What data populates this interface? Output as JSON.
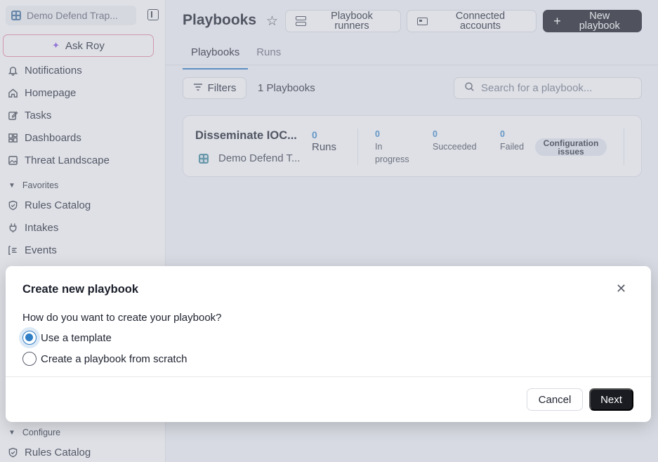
{
  "sidebar": {
    "workspace_name": "Demo Defend Trap...",
    "ask_label": "Ask Roy",
    "items": [
      {
        "label": "Notifications",
        "icon": "bell-icon"
      },
      {
        "label": "Homepage",
        "icon": "home-icon"
      },
      {
        "label": "Tasks",
        "icon": "edit-icon"
      },
      {
        "label": "Dashboards",
        "icon": "dashboard-icon"
      },
      {
        "label": "Threat Landscape",
        "icon": "image-icon"
      },
      {
        "label": "Rules Catalog",
        "icon": "shield-icon"
      },
      {
        "label": "Intakes",
        "icon": "plug-icon"
      },
      {
        "label": "Events",
        "icon": "events-icon"
      },
      {
        "label": "Rules Catalog",
        "icon": "shield-icon"
      }
    ],
    "section_favorites": "Favorites",
    "section_configure": "Configure"
  },
  "header": {
    "title": "Playbooks",
    "runners_label": "Playbook runners",
    "accounts_label": "Connected accounts",
    "new_label": "New playbook"
  },
  "tabs": [
    {
      "label": "Playbooks",
      "active": true
    },
    {
      "label": "Runs",
      "active": false
    }
  ],
  "toolbar": {
    "filters_label": "Filters",
    "count_label": "1 Playbooks",
    "search_placeholder": "Search for a playbook..."
  },
  "playbook": {
    "name": "Disseminate IOC...",
    "workspace": "Demo Defend T...",
    "runs_count": "0",
    "runs_label": "Runs",
    "in_progress_count": "0",
    "in_progress_label": "In progress",
    "succeeded_count": "0",
    "succeeded_label": "Succeeded",
    "failed_count": "0",
    "failed_label": "Failed",
    "status_badge": "Configuration issues"
  },
  "modal": {
    "title": "Create new playbook",
    "question": "How do you want to create your playbook?",
    "options": [
      {
        "label": "Use a template",
        "selected": true
      },
      {
        "label": "Create a playbook from scratch",
        "selected": false
      }
    ],
    "cancel_label": "Cancel",
    "next_label": "Next"
  },
  "colors": {
    "accent": "#2f7ec6",
    "primary_button": "#1a1c22",
    "ask_border": "#e98aa0"
  }
}
